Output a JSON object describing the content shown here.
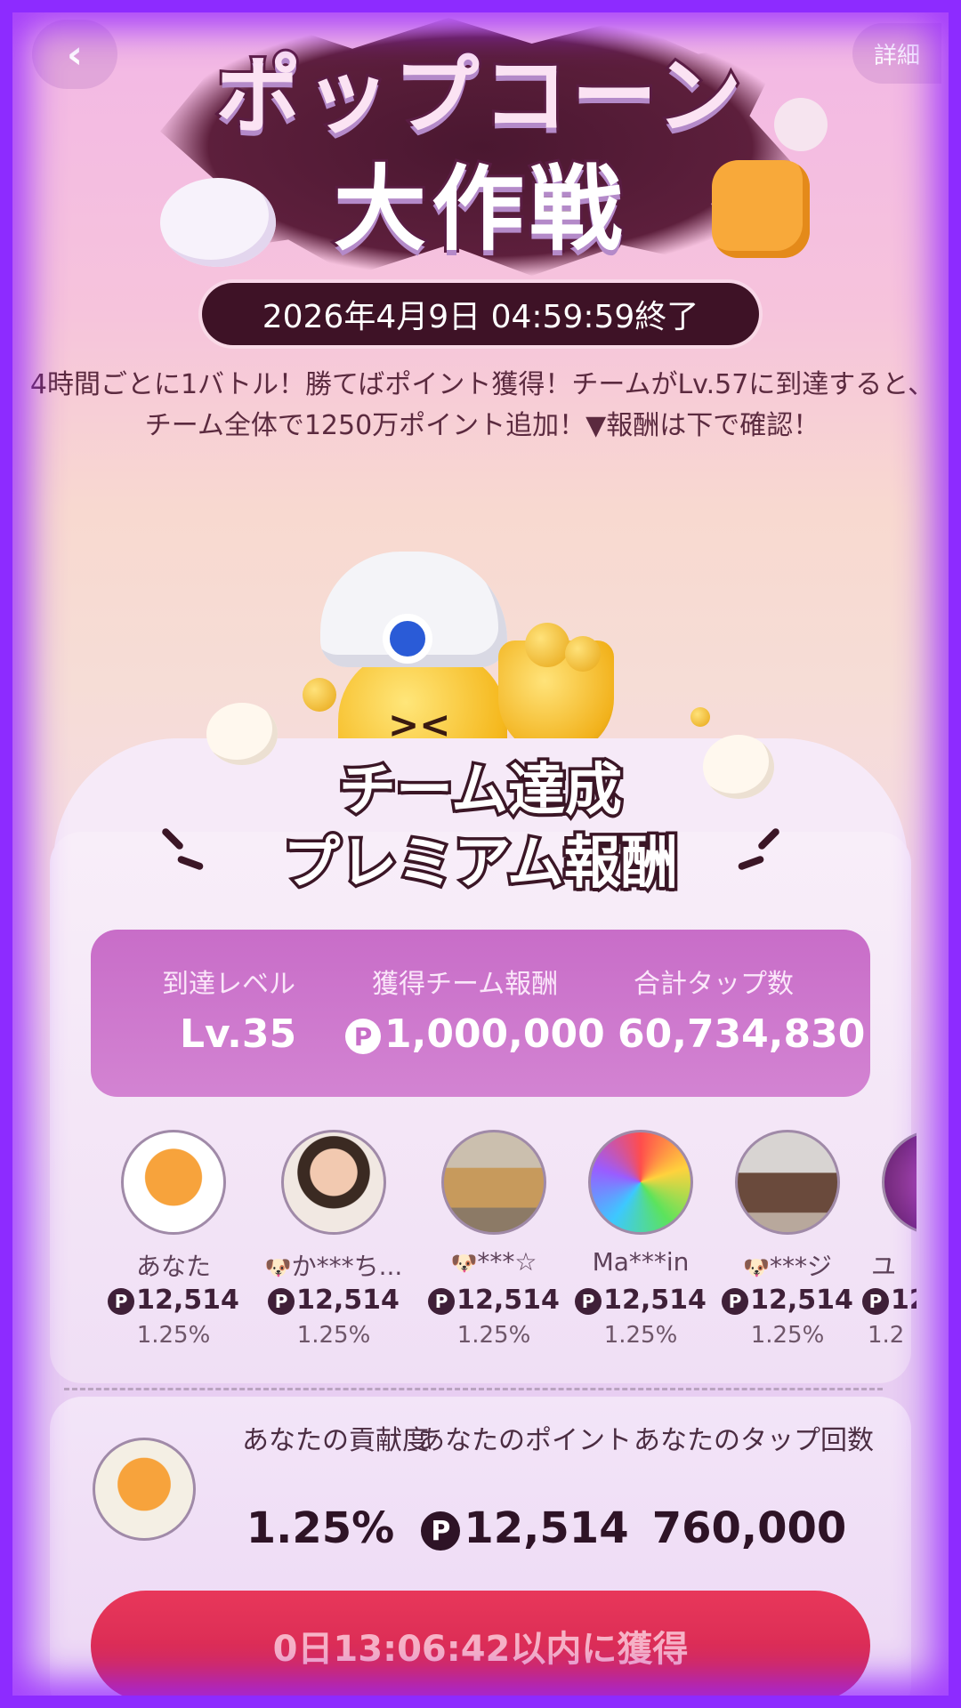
{
  "header": {
    "back_icon": "chevron-left-icon",
    "detail_label": "詳細",
    "title_line1": "ポップコーン",
    "title_line2": "大作戦",
    "end_date": "2026年4月9日 04:59:59終了",
    "description": "4時間ごとに1バトル！勝てばポイント獲得！チームがLv.57に到達すると、チーム全体で1250万ポイント追加！▼報酬は下で確認！"
  },
  "reward": {
    "title_line1": "チーム達成",
    "title_line2": "プレミアム報酬",
    "stats": {
      "level_label": "到達レベル",
      "level_value": "Lv.35",
      "reward_label": "獲得チーム報酬",
      "reward_value": "1,000,000",
      "taps_label": "合計タップ数",
      "taps_value": "60,734,830",
      "coin_symbol": "P"
    }
  },
  "members": [
    {
      "name": "あなた",
      "points": "12,514",
      "pct": "1.25%",
      "badge": ""
    },
    {
      "name": "か***ち...",
      "points": "12,514",
      "pct": "1.25%",
      "badge": "dog-icon"
    },
    {
      "name": "***☆",
      "points": "12,514",
      "pct": "1.25%",
      "badge": "dog-icon"
    },
    {
      "name": "Ma***in",
      "points": "12,514",
      "pct": "1.25%",
      "badge": ""
    },
    {
      "name": "***ジ",
      "points": "12,514",
      "pct": "1.25%",
      "badge": "dog-icon"
    },
    {
      "name": "ユ",
      "points": "12",
      "pct": "1.2",
      "badge": ""
    }
  ],
  "contribution": {
    "contrib_label": "あなたの貢献度",
    "contrib_value": "1.25%",
    "points_label": "あなたのポイント",
    "points_value": "12,514",
    "taps_label": "あなたのタップ回数",
    "taps_value": "760,000"
  },
  "cta": {
    "label": "0日13:06:42以内に獲得"
  },
  "colors": {
    "frame": "#8d2bff",
    "stats_box": "#c86dc8",
    "cta": "#d02452",
    "date_pill": "#3e1226"
  }
}
